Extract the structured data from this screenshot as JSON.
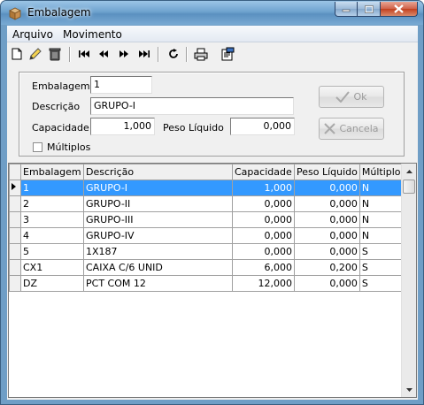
{
  "window": {
    "title": "Embalagem"
  },
  "menu": {
    "items": [
      "Arquivo",
      "Movimento"
    ]
  },
  "form": {
    "embalagem_label": "Embalagem",
    "embalagem_value": "1",
    "descricao_label": "Descrição",
    "descricao_value": "GRUPO-I",
    "capacidade_label": "Capacidade",
    "capacidade_value": "1,000",
    "peso_label": "Peso Líquido",
    "peso_value": "0,000",
    "multiplos_label": "Múltiplos",
    "ok_label": "Ok",
    "cancela_label": "Cancela"
  },
  "grid": {
    "columns": [
      "Embalagem",
      "Descrição",
      "Capacidade",
      "Peso Líquido",
      "Múltiplos"
    ],
    "rows": [
      [
        "1",
        "GRUPO-I",
        "1,000",
        "0,000",
        "N"
      ],
      [
        "2",
        "GRUPO-II",
        "0,000",
        "0,000",
        "N"
      ],
      [
        "3",
        "GRUPO-III",
        "0,000",
        "0,000",
        "N"
      ],
      [
        "4",
        "GRUPO-IV",
        "0,000",
        "0,000",
        "N"
      ],
      [
        "5",
        "1X187",
        "0,000",
        "0,000",
        "S"
      ],
      [
        "CX1",
        "CAIXA C/6 UNID",
        "6,000",
        "0,200",
        "S"
      ],
      [
        "DZ",
        "PCT COM 12",
        "12,000",
        "0,000",
        "S"
      ]
    ],
    "selected_row": 0
  },
  "colors": {
    "selection": "#3399ff",
    "title_bar": "#6fa3cf",
    "close_button": "#c2401f"
  },
  "icons": [
    "new-icon",
    "edit-icon",
    "delete-icon",
    "first-record-icon",
    "previous-record-icon",
    "next-record-icon",
    "last-record-icon",
    "refresh-icon",
    "print-icon",
    "properties-icon"
  ]
}
